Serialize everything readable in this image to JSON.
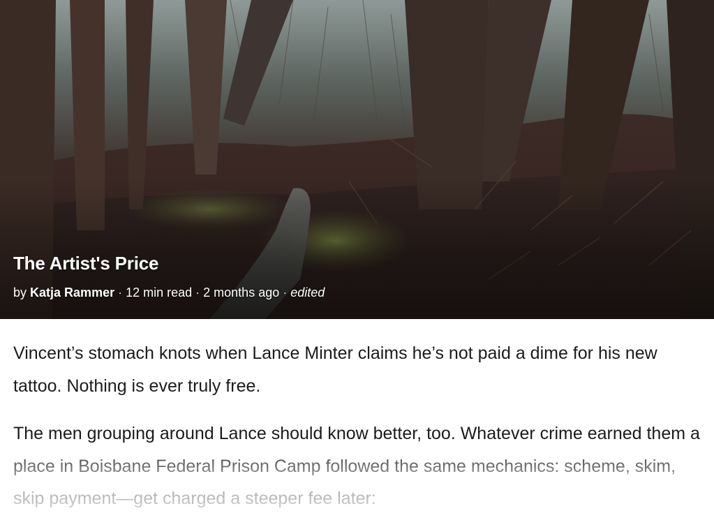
{
  "story": {
    "title": "The Artist's Price",
    "byline_prefix": "by",
    "author": "Katja Rammer",
    "read_time": "12 min read",
    "published": "2 months ago",
    "status": "edited"
  },
  "content": {
    "paragraphs": [
      "Vincent’s stomach knots when Lance Minter claims he’s not paid a dime for his new tattoo. Nothing is ever truly free.",
      "The men grouping around Lance should know better, too. Whatever crime earned them a place in Boisbane Federal Prison Camp followed the same mechanics: scheme, skim, skip payment—get charged a steeper fee later:"
    ]
  },
  "colors": {
    "text": "#1b1b1b",
    "hero_text": "#ffffff",
    "background": "#ffffff"
  }
}
